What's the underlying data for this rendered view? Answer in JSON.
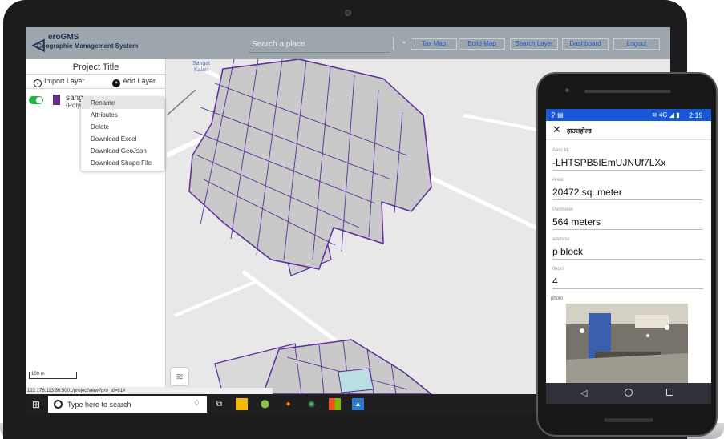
{
  "app": {
    "logo": {
      "name": "eroGMS",
      "subtitle": "Geographic Management System",
      "mark": "◁"
    },
    "search": {
      "placeholder": "Search a place"
    },
    "nav": [
      "Tax Map",
      "Build Map",
      "Search Layer",
      "Dashboard",
      "Logout"
    ],
    "colors": {
      "header": "#9da5ad",
      "nav_text": "#1e5bd3",
      "parcel": "#5b2c9c",
      "toggle": "#1db544"
    }
  },
  "panel": {
    "project_title": "Project Title",
    "import_label": "Import Layer",
    "add_label": "Add Layer",
    "layer": {
      "name": "sang",
      "type": "(Polyg"
    },
    "menu": [
      "Rename",
      "Attributes",
      "Delete",
      "Download Excel",
      "Download GeoJson",
      "Download Shape File"
    ],
    "scale": "100 m",
    "url": "122.176.113.56:5001/projectView?pro_id=61#"
  },
  "map": {
    "label": "Sangat Kalan"
  },
  "taskbar": {
    "search_text": "Type here to search",
    "icons": [
      "task-view-icon",
      "file-explorer-icon",
      "maps-icon",
      "firefox-icon",
      "chrome-icon",
      "office-icon",
      "photos-icon"
    ]
  },
  "phone": {
    "status": {
      "time": "2:19",
      "network": "4G"
    },
    "title": "हाउसहोल्ड",
    "fields": [
      {
        "label": "Aero Id:",
        "value": "-LHTSPB5IEmUJNUf7LXx"
      },
      {
        "label": "Area:",
        "value": "20472 sq. meter"
      },
      {
        "label": "Perimeter",
        "value": "564 meters"
      },
      {
        "label": "address",
        "value": "p block"
      },
      {
        "label": "floors",
        "value": "4"
      }
    ],
    "photo_label": "photo"
  }
}
